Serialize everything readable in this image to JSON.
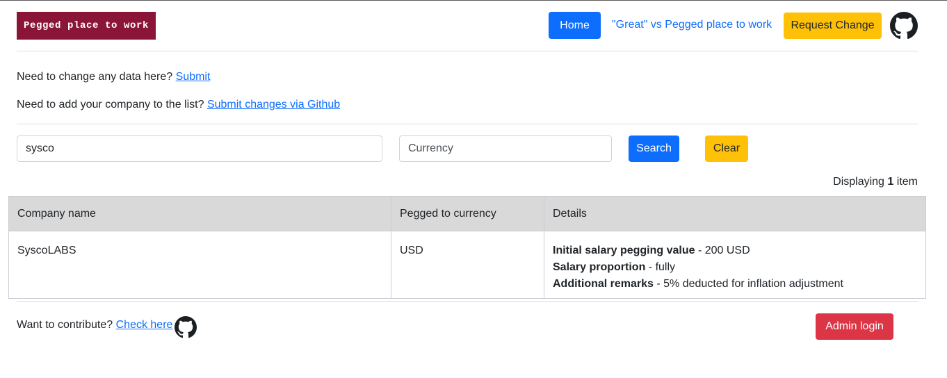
{
  "header": {
    "brand": "Pegged place to work",
    "nav": {
      "home": "Home",
      "compare": "\"Great\" vs Pegged place to work",
      "request_change": "Request Change"
    },
    "github_icon": "github-icon"
  },
  "intro": {
    "change_prefix": "Need to change any data here?",
    "change_link": "Submit",
    "add_prefix": "Need to add your company to the list?",
    "add_link": "Submit changes via Github"
  },
  "search": {
    "company_value": "sysco",
    "currency_placeholder": "Currency",
    "search_label": "Search",
    "clear_label": "Clear"
  },
  "results": {
    "prefix": "Displaying",
    "count": "1",
    "suffix": "item"
  },
  "table": {
    "columns": [
      "Company name",
      "Pegged to currency",
      "Details"
    ],
    "rows": [
      {
        "company": "SyscoLABS",
        "currency": "USD",
        "details": [
          {
            "label": "Initial salary pegging value",
            "value": " - 200 USD"
          },
          {
            "label": "Salary proportion",
            "value": " - fully"
          },
          {
            "label": "Additional remarks",
            "value": " - 5% deducted for inflation adjustment"
          }
        ]
      }
    ]
  },
  "footer": {
    "prefix": "Want to contribute?",
    "link": "Check here",
    "admin_login": "Admin login"
  },
  "colors": {
    "brand": "#8b1538",
    "primary": "#0d6efd",
    "warning": "#ffc107",
    "danger": "#dc3545"
  }
}
